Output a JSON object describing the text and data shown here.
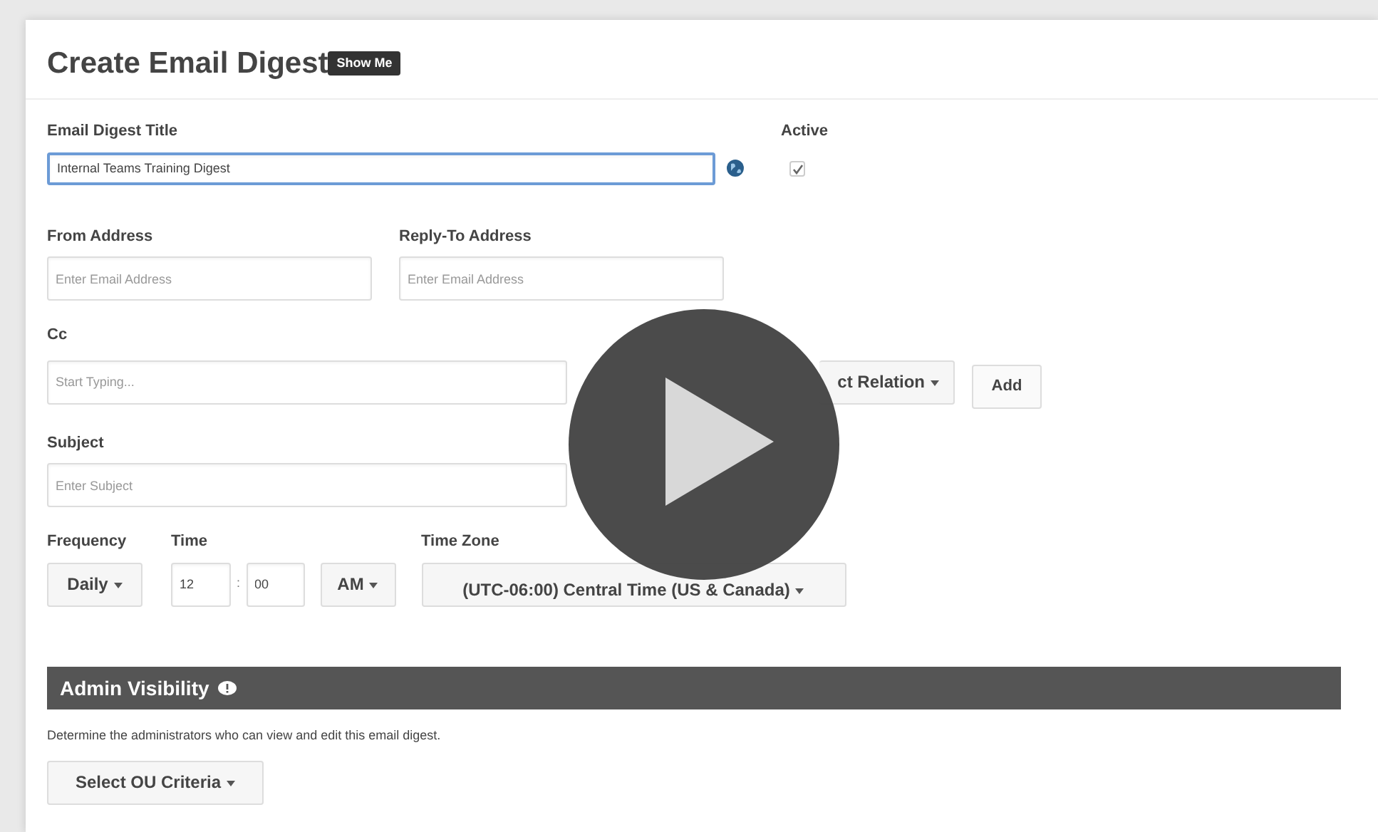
{
  "heading": "Create Email Digest",
  "show_me_button": "Show Me",
  "title_field": {
    "label": "Email Digest Title",
    "value": "Internal Teams Training Digest"
  },
  "active": {
    "label": "Active",
    "checked": true
  },
  "from_field": {
    "label": "From Address",
    "placeholder": "Enter Email Address"
  },
  "reply_to_field": {
    "label": "Reply-To Address",
    "placeholder": "Enter Email Address"
  },
  "cc_field": {
    "label": "Cc",
    "placeholder": "Start Typing..."
  },
  "relation_dropdown": "ct Relation",
  "add_button": "Add",
  "subject_field": {
    "label": "Subject",
    "placeholder": "Enter Subject"
  },
  "frequency": {
    "label": "Frequency",
    "value": "Daily"
  },
  "time": {
    "label": "Time",
    "hour": "12",
    "separator": ":",
    "minute": "00",
    "meridiem": "AM"
  },
  "time_zone": {
    "label": "Time Zone",
    "value": "(UTC-06:00) Central Time (US & Canada)"
  },
  "admin_visibility": {
    "title": "Admin Visibility",
    "description": "Determine the administrators who can view and edit this email digest.",
    "dropdown": "Select OU Criteria"
  },
  "video_overlay": {
    "kind": "play"
  }
}
